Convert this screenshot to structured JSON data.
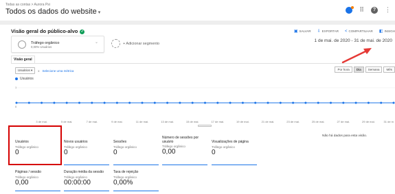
{
  "header": {
    "breadcrumb": "Todas as contas > Aurora Psi",
    "account_title": "Todos os dados do website",
    "caret": "▾",
    "icons": [
      "notifications-icon",
      "apps-grid-icon",
      "help-icon",
      "more-vert-icon"
    ]
  },
  "overview": {
    "title": "Visão geral do público-alvo",
    "status_icon": "✓",
    "actions": {
      "save": "SALVAR",
      "export": "EXPORTAR",
      "share": "COMPARTILHAR",
      "insights": "INSIGH"
    },
    "date_range": "1 de mai. de 2020 - 31 de mai. de 2020"
  },
  "segments": {
    "active": {
      "name": "Tráfego orgânico",
      "sub": "0,00% Usuários"
    },
    "add_label": "+ Adicionar segmento"
  },
  "tabs": {
    "overview": "Visão geral"
  },
  "metric_selector": {
    "metric": "Usuários",
    "caret": "▾",
    "vs": "x",
    "pick": "Selecione uma métrica",
    "periods": [
      "Por hora",
      "Dia",
      "Semana",
      "Mês"
    ],
    "active_period": "Dia"
  },
  "chart_data": {
    "type": "line",
    "series": [
      {
        "name": "Usuários",
        "values": [
          0,
          0,
          0,
          0,
          0,
          0,
          0,
          0,
          0,
          0,
          0,
          0,
          0,
          0,
          0,
          0,
          0,
          0,
          0,
          0,
          0,
          0,
          0,
          0,
          0,
          0,
          0,
          0,
          0,
          0,
          0
        ]
      }
    ],
    "y_ticks": [
      "1",
      "0"
    ],
    "x_ticks": [
      "3 de mai.",
      "5 de mai.",
      "7 de mai.",
      "9 de mai.",
      "11 de mai.",
      "13 de mai.",
      "15 de mai.",
      "17 de mai.",
      "19 de mai.",
      "21 de mai.",
      "23 de mai.",
      "25 de mai.",
      "27 de mai.",
      "29 de mai.",
      "31 de m"
    ],
    "color": "#1a73e8"
  },
  "no_data": "Não há dados para esta visão.",
  "scorecards": [
    {
      "name": "Usuários",
      "segment": "Tráfego orgânico",
      "value": "0"
    },
    {
      "name": "Novos usuários",
      "segment": "Tráfego orgânico",
      "value": "0"
    },
    {
      "name": "Sessões",
      "segment": "Tráfego orgânico",
      "value": "0"
    },
    {
      "name": "Número de sessões por usuário",
      "segment": "Tráfego orgânico",
      "value": "0,00"
    },
    {
      "name": "Visualizações de página",
      "segment": "Tráfego orgânico",
      "value": "0"
    },
    {
      "name": "Páginas / sessão",
      "segment": "Tráfego orgânico",
      "value": "0,00"
    },
    {
      "name": "Duração média da sessão",
      "segment": "Tráfego orgânico",
      "value": "00:00:00"
    },
    {
      "name": "Taxa de rejeição",
      "segment": "Tráfego orgânico",
      "value": "0,00%"
    }
  ],
  "colors": {
    "accent": "#1a73e8",
    "highlight": "#d50000",
    "ok": "#0f9d58"
  }
}
